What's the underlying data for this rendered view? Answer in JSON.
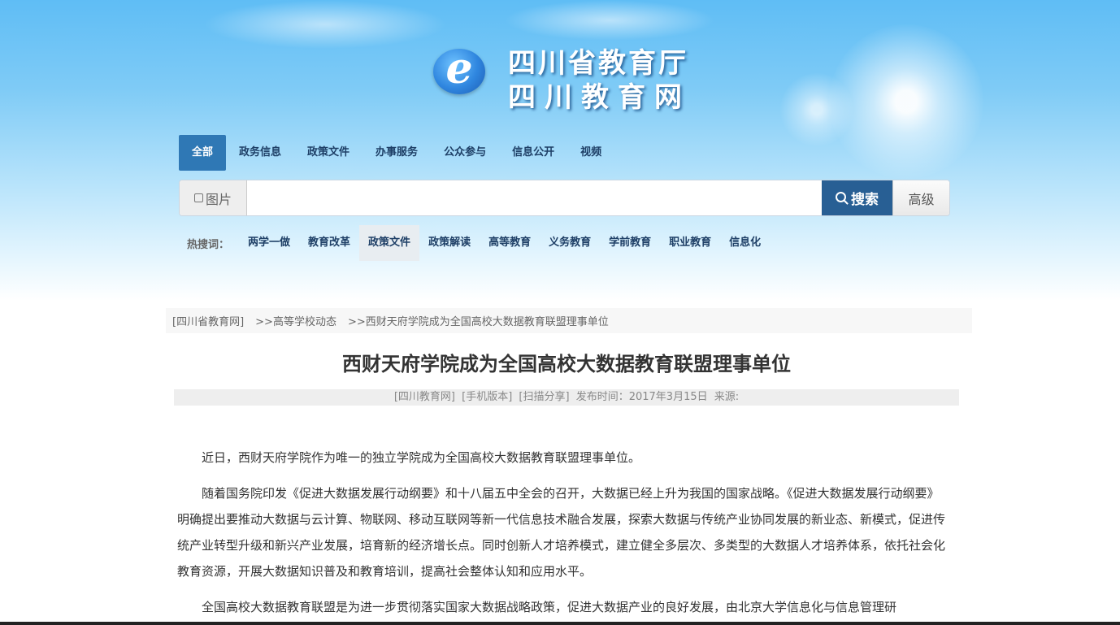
{
  "header": {
    "title_line1": "四川省教育厅",
    "title_line2": "四川教育网",
    "logo_letter": "e"
  },
  "nav": {
    "tabs": [
      "全部",
      "政务信息",
      "政策文件",
      "办事服务",
      "公众参与",
      "信息公开",
      "视频"
    ]
  },
  "search": {
    "image_checkbox_label": "图片",
    "placeholder": "",
    "search_button": "搜索",
    "advanced_button": "高级"
  },
  "hot": {
    "label": "热搜词：",
    "items": [
      "两学一做",
      "教育改革",
      "政策文件",
      "政策解读",
      "高等教育",
      "义务教育",
      "学前教育",
      "职业教育",
      "信息化"
    ]
  },
  "breadcrumb": {
    "items": [
      "[四川省教育网]",
      ">>高等学校动态",
      ">>西财天府学院成为全国高校大数据教育联盟理事单位"
    ]
  },
  "article": {
    "title": "西财天府学院成为全国高校大数据教育联盟理事单位",
    "meta": {
      "source_link": "[四川教育网]",
      "mobile_link": "[手机版本]",
      "share_link": "[扫描分享]",
      "date": "发布时间：2017年3月15日",
      "origin": "来源:"
    },
    "paragraphs": [
      "近日，西财天府学院作为唯一的独立学院成为全国高校大数据教育联盟理事单位。",
      "随着国务院印发《促进大数据发展行动纲要》和十八届五中全会的召开，大数据已经上升为我国的国家战略。《促进大数据发展行动纲要》明确提出要推动大数据与云计算、物联网、移动互联网等新一代信息技术融合发展，探索大数据与传统产业协同发展的新业态、新模式，促进传统产业转型升级和新兴产业发展，培育新的经济增长点。同时创新人才培养模式，建立健全多层次、多类型的大数据人才培养体系，依托社会化教育资源，开展大数据知识普及和教育培训，提高社会整体认知和应用水平。",
      "全国高校大数据教育联盟是为进一步贯彻落实国家大数据战略政策，促进大数据产业的良好发展，由北京大学信息化与信息管理研"
    ]
  },
  "colors": {
    "nav_active": "#2f78b5",
    "search_button": "#285f94",
    "link_text": "#1e3f66"
  }
}
